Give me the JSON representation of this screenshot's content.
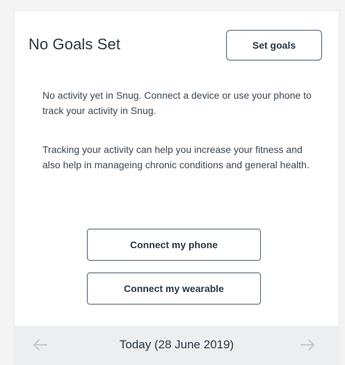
{
  "header": {
    "title": "No Goals Set",
    "set_goals_label": "Set goals"
  },
  "content": {
    "paragraph_1": "No activity yet in Snug. Connect a device or use your phone to track your activity in Snug.",
    "paragraph_2": "Tracking your activity can help you increase your fitness and also help in manageing chronic conditions and general health."
  },
  "actions": {
    "connect_phone_label": "Connect my phone",
    "connect_wearable_label": "Connect my wearable"
  },
  "footer": {
    "date_label": "Today (28 June 2019)",
    "prev_icon": "arrow-left-icon",
    "next_icon": "arrow-right-icon"
  },
  "colors": {
    "background": "#f4f4f4",
    "card": "#ffffff",
    "footer": "#eceeef",
    "text": "#2b3642",
    "border": "#4b5c6b",
    "arrow": "#c4c9ce"
  }
}
